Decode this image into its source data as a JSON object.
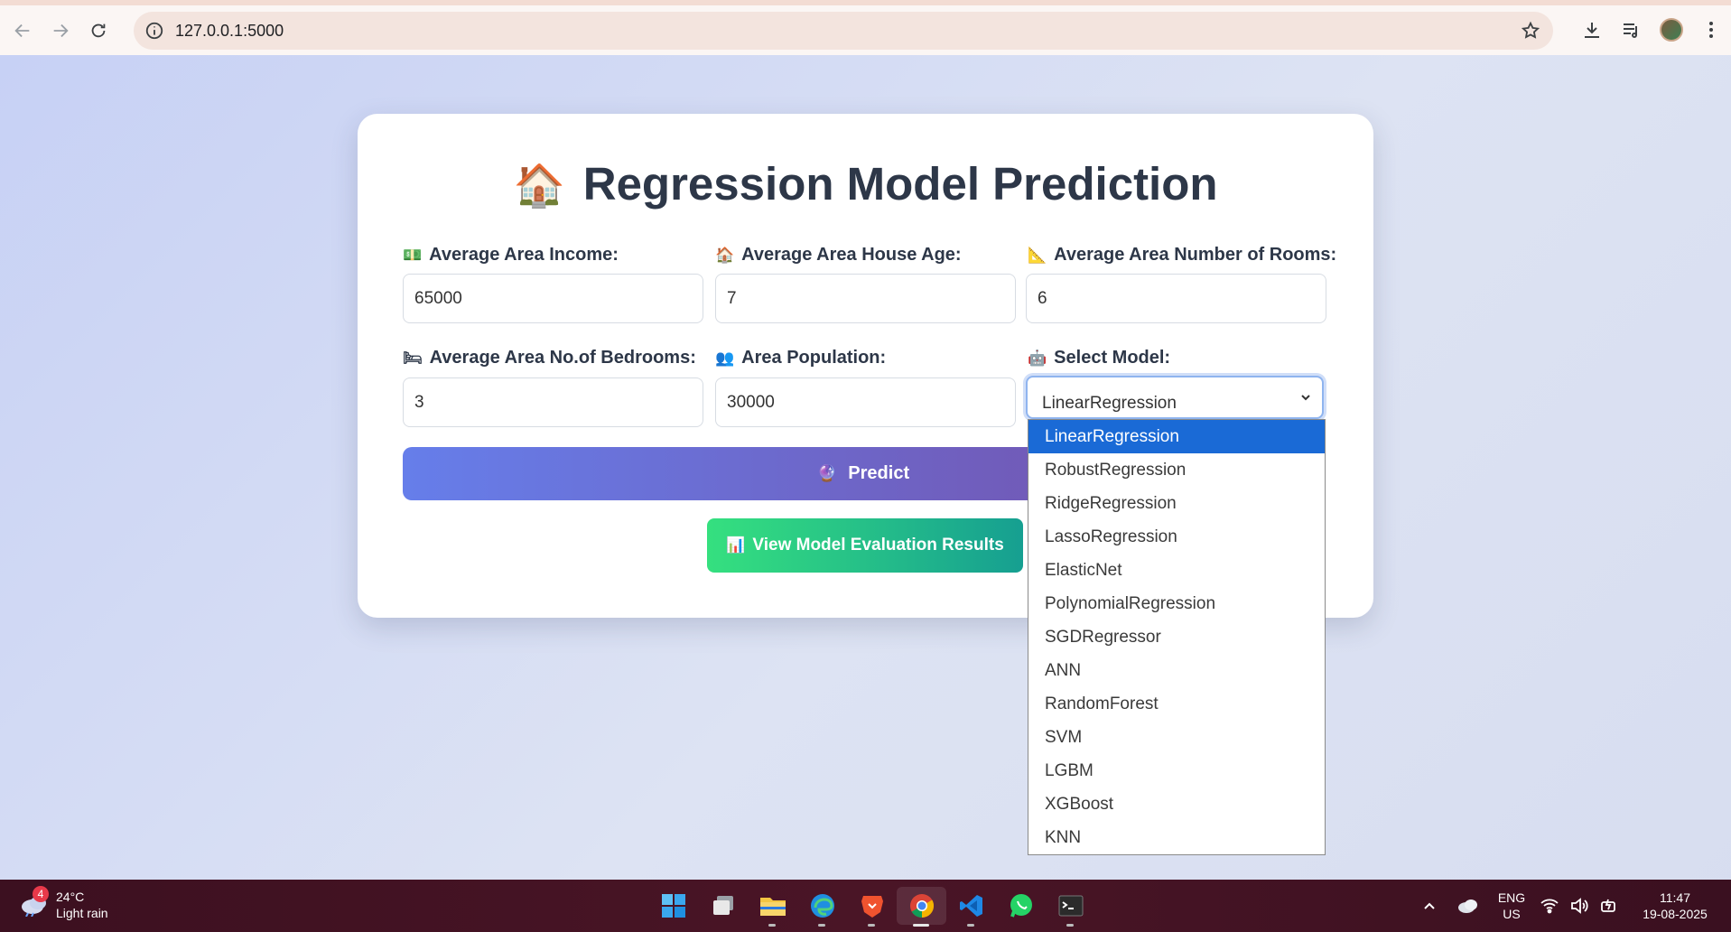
{
  "browser": {
    "url": "127.0.0.1:5000"
  },
  "page": {
    "title_icon": "🏠",
    "title": "Regression Model Prediction",
    "fields": [
      {
        "icon": "💵",
        "label": "Average Area Income:",
        "value": "65000"
      },
      {
        "icon": "🏠",
        "label": "Average Area House Age:",
        "value": "7"
      },
      {
        "icon": "📐",
        "label": "Average Area Number of Rooms:",
        "value": "6"
      },
      {
        "icon": "🛏",
        "label": "Average Area No.of Bedrooms:",
        "value": "3"
      },
      {
        "icon": "👥",
        "label": "Area Population:",
        "value": "30000"
      }
    ],
    "model_select": {
      "icon": "🤖",
      "label": "Select Model:",
      "selected": "LinearRegression",
      "options": [
        "LinearRegression",
        "RobustRegression",
        "RidgeRegression",
        "LassoRegression",
        "ElasticNet",
        "PolynomialRegression",
        "SGDRegressor",
        "ANN",
        "RandomForest",
        "SVM",
        "LGBM",
        "XGBoost",
        "KNN"
      ]
    },
    "predict_button": {
      "icon": "🔮",
      "label": "Predict"
    },
    "eval_button": {
      "icon": "📊",
      "label": "View Model Evaluation Results"
    }
  },
  "taskbar": {
    "weather_badge": "4",
    "temperature": "24°C",
    "weather": "Light rain",
    "lang_top": "ENG",
    "lang_bottom": "US",
    "time": "11:47",
    "date": "19-08-2025"
  },
  "colors": {
    "predict_gradient": [
      "#667eea",
      "#764ba2"
    ],
    "eval_gradient": [
      "#35e07f",
      "#169f91"
    ],
    "dropdown_selected": "#1a6ad6"
  }
}
